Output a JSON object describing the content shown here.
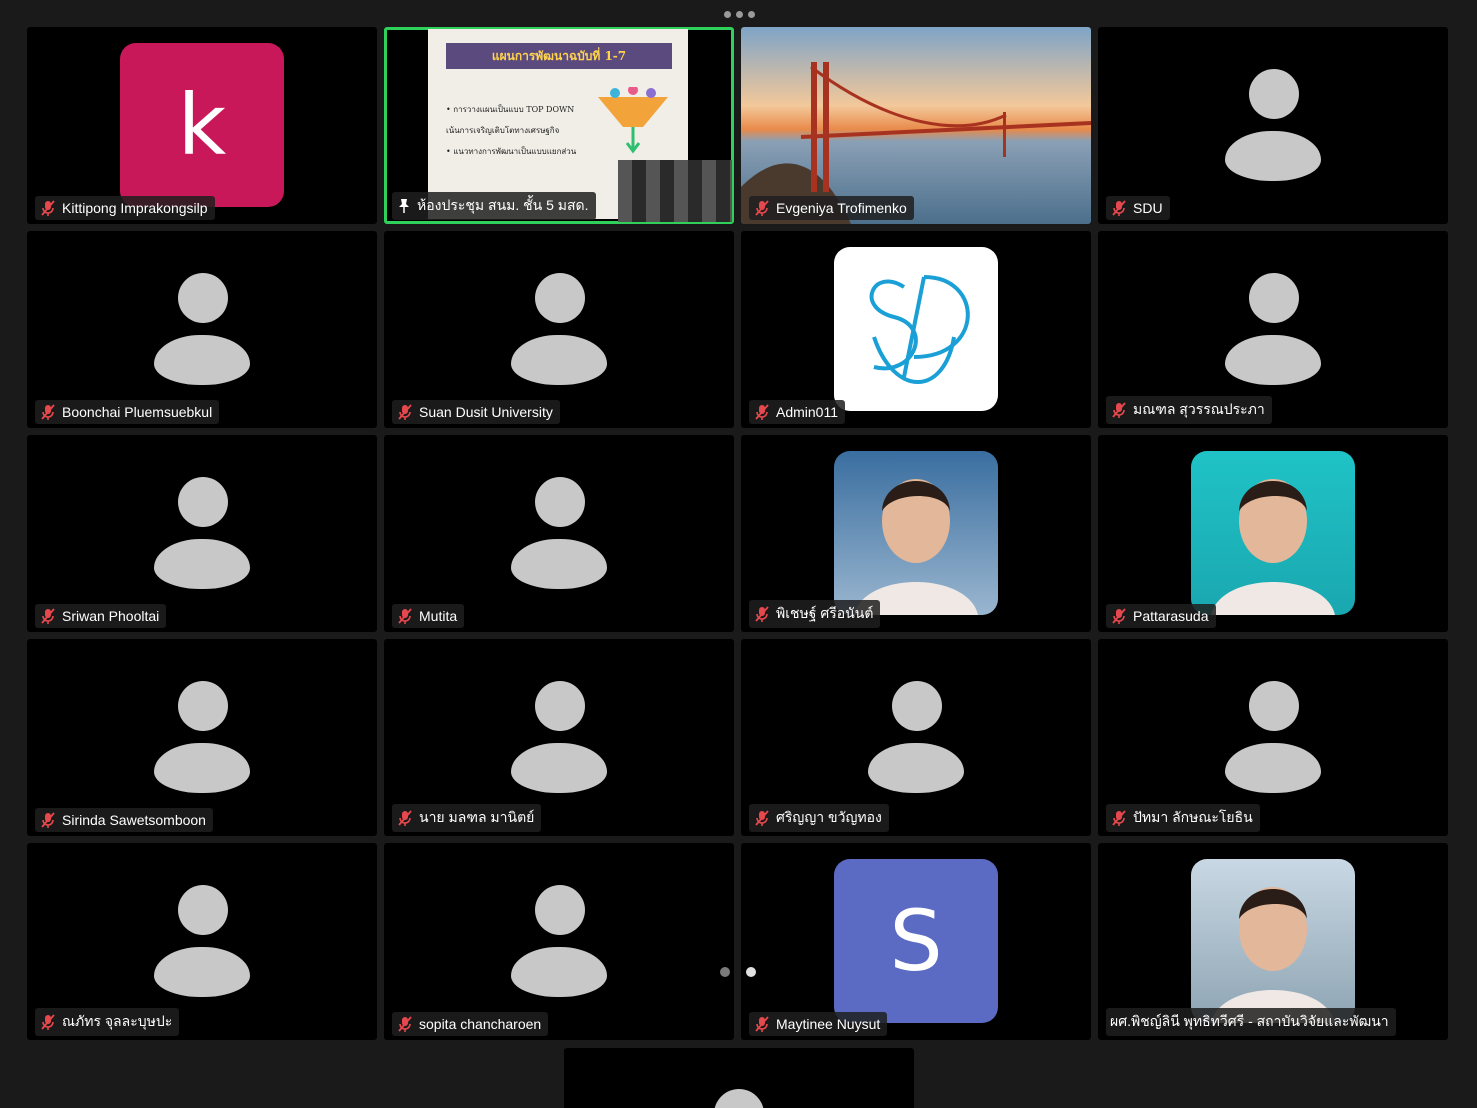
{
  "colors": {
    "accent_active": "#2fd15b",
    "tile_bg": "#000000",
    "avatar_grey": "#c8c8c8"
  },
  "tiles": [
    {
      "name": "Kittipong Imprakongsilp",
      "avatar": "letter",
      "letter": "k",
      "avatar_color": "#c8185a"
    },
    {
      "name": "ห้องประชุม สนม. ชั้น 5 มสด.",
      "avatar": "screen-share",
      "active": true,
      "pinned": true
    },
    {
      "name": "Evgeniya Trofimenko",
      "avatar": "photo-landscape"
    },
    {
      "name": "SDU",
      "avatar": "default"
    },
    {
      "name": "Boonchai Pluemsuebkul",
      "avatar": "default"
    },
    {
      "name": "Suan Dusit University",
      "avatar": "default"
    },
    {
      "name": "Admin011",
      "avatar": "logo-sdu"
    },
    {
      "name": "มณฑล สุวรรณประภา",
      "avatar": "default"
    },
    {
      "name": "Sriwan  Phooltai",
      "avatar": "default"
    },
    {
      "name": "Mutita",
      "avatar": "default"
    },
    {
      "name": "พิเชษฐ์ ศรีอนันต์",
      "avatar": "photo-portrait"
    },
    {
      "name": "Pattarasuda",
      "avatar": "photo-portrait"
    },
    {
      "name": "Sirinda Sawetsomboon",
      "avatar": "default"
    },
    {
      "name": "นาย  มลฑล มานิตย์",
      "avatar": "default"
    },
    {
      "name": "ศริญญา ขวัญทอง",
      "avatar": "default"
    },
    {
      "name": "ปัทมา ลักษณะโยธิน",
      "avatar": "default"
    },
    {
      "name": "ณภัทร จุลละบุษปะ",
      "avatar": "default"
    },
    {
      "name": "sopita chancharoen",
      "avatar": "default"
    },
    {
      "name": "Maytinee Nuysut",
      "avatar": "letter",
      "letter": "S",
      "avatar_color": "#5b6bc4"
    },
    {
      "name": "ผศ.พิชญ์ลินี พุทธิทวีศรี - สถาบันวิจัยและพัฒนา",
      "avatar": "photo-portrait",
      "no_mic": true
    }
  ],
  "slide": {
    "title": "แผนการพัฒนาฉบับที่ 1-7",
    "bullets": [
      "• การวางแผนเป็นแบบ TOP DOWN",
      "เน้นการเจริญเติบโตทางเศรษฐกิจ",
      "• แนวทางการพัฒนาเป็นแบบแยกส่วน"
    ]
  },
  "pager": {
    "pages": 2,
    "current": 2
  }
}
